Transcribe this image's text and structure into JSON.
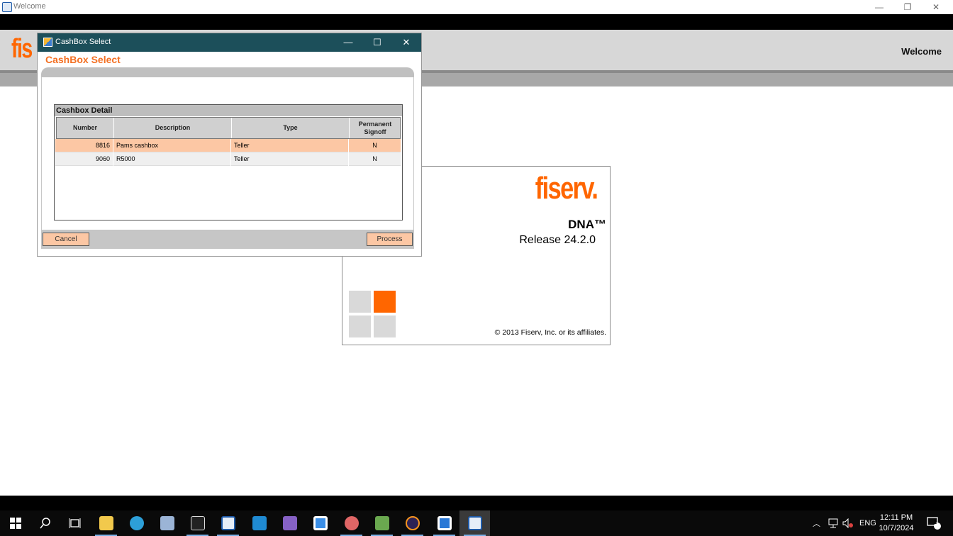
{
  "window": {
    "title": "Welcome",
    "controls": [
      "minimize",
      "restore",
      "close"
    ]
  },
  "header": {
    "logo_text": "fis",
    "welcome": "Welcome"
  },
  "splash": {
    "brand": "fiserv.",
    "product": "DNA™",
    "release": "Release 24.2.0",
    "copyright": "© 2013 Fiserv, Inc. or its affiliates.",
    "colors": {
      "accent": "#ff6600",
      "tile": "#d9d9d9"
    }
  },
  "dialog": {
    "title": "CashBox Select",
    "heading": "CashBox Select",
    "section_title": "Cashbox Detail",
    "columns": [
      "Number",
      "Description",
      "Type",
      "Permanent Signoff"
    ],
    "rows": [
      {
        "number": "8816",
        "description": "Pams cashbox",
        "type": "Teller",
        "signoff": "N",
        "selected": true
      },
      {
        "number": "9060",
        "description": "R5000",
        "type": "Teller",
        "signoff": "N",
        "selected": false
      }
    ],
    "cancel_label": "Cancel",
    "process_label": "Process"
  },
  "taskbar": {
    "icons": [
      "windows-start-icon",
      "search-icon",
      "task-view-icon",
      "file-explorer-icon",
      "edge-icon",
      "app-icon",
      "terminal-icon",
      "dna-app-icon",
      "vscode-icon",
      "visual-studio-icon",
      "app-window-icon",
      "paint-icon",
      "notepad-icon",
      "eclipse-icon",
      "app-window-2-icon",
      "dna-welcome-icon"
    ],
    "language": "ENG",
    "time": "12:11 PM",
    "date": "10/7/2024",
    "notification_count": "1"
  }
}
